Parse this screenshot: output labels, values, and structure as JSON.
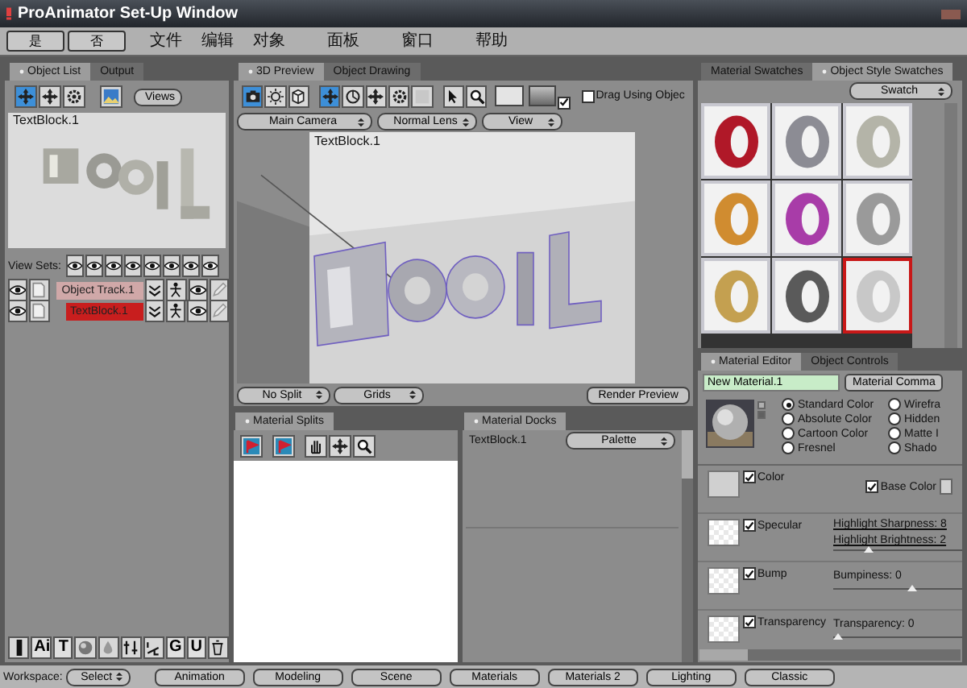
{
  "window": {
    "title": "ProAnimator Set-Up Window"
  },
  "dialog_buttons": [
    "是",
    "否"
  ],
  "menu": [
    "文件",
    "编辑",
    "对象",
    "面板",
    "窗口",
    "帮助"
  ],
  "object_list_panel": {
    "tabs": [
      {
        "label": "Object List",
        "selected": true
      },
      {
        "label": "Output",
        "selected": false
      }
    ],
    "toolbar": [
      {
        "selected": true
      },
      {
        "selected": false
      },
      {
        "selected": false
      },
      {
        "selected": false
      }
    ],
    "views_dropdown": "Views",
    "preview_label": "TextBlock.1",
    "view_sets_label": "View Sets:",
    "tracks": [
      {
        "name": "Object Track.1",
        "selected": false,
        "children": [
          {
            "name": "TextBlock.1",
            "selected": true
          }
        ]
      }
    ],
    "tools": [
      {
        "kind": "icon"
      },
      {
        "kind": "text",
        "label": "Ai"
      },
      {
        "kind": "text",
        "label": "T"
      },
      {
        "kind": "icon"
      },
      {
        "kind": "icon"
      },
      {
        "kind": "icon"
      },
      {
        "kind": "icon"
      },
      {
        "kind": "text",
        "label": "G"
      },
      {
        "kind": "text",
        "label": "U"
      },
      {
        "kind": "icon"
      }
    ]
  },
  "preview_panel": {
    "tabs": [
      {
        "label": "3D Preview",
        "selected": true
      },
      {
        "label": "Object Drawing",
        "selected": false
      }
    ],
    "toolbar": [
      {
        "selected": true
      },
      {
        "selected": false
      },
      {
        "selected": false
      },
      {
        "selected": true
      },
      {
        "selected": false
      },
      {
        "selected": false
      },
      {
        "selected": false
      },
      {
        "selected": false
      },
      {
        "selected": false
      },
      {
        "selected": false
      }
    ],
    "background_toggle": {
      "checked": true
    },
    "drag_using_objects": {
      "label": "Drag Using Objec",
      "checked": false
    },
    "camera": "Main Camera",
    "lens": "Normal Lens",
    "view": "View",
    "viewport_label": "TextBlock.1",
    "split": "No Split",
    "grids": "Grids",
    "render_button": "Render Preview"
  },
  "material_splits": {
    "tab": "Material Splits"
  },
  "material_docks": {
    "tab": "Material Docks",
    "object": "TextBlock.1",
    "palette": "Palette"
  },
  "swatch_panel": {
    "tabs": [
      {
        "label": "Material Swatches",
        "selected": false
      },
      {
        "label": "Object Style Swatches",
        "selected": true
      }
    ],
    "dropdown": "Swatch",
    "swatches": [
      {
        "color": "#b01828",
        "selected": false
      },
      {
        "color": "#8c8c94",
        "selected": false
      },
      {
        "color": "#b4b4a8",
        "selected": false
      },
      {
        "color": "#d08c30",
        "selected": false
      },
      {
        "color": "#a83ca8",
        "selected": false
      },
      {
        "color": "#9a9a9a",
        "selected": false
      },
      {
        "color": "#c4a050",
        "selected": false
      },
      {
        "color": "#5a5a5a",
        "selected": false
      },
      {
        "color": "#c8c8c8",
        "selected": true
      }
    ]
  },
  "material_editor": {
    "tabs": [
      {
        "label": "Material Editor",
        "selected": true
      },
      {
        "label": "Object Controls",
        "selected": false
      }
    ],
    "name": "New Material.1",
    "command_button": "Material Comma",
    "color_modes": [
      {
        "label": "Standard Color",
        "selected": true
      },
      {
        "label": "Absolute Color",
        "selected": false
      },
      {
        "label": "Cartoon Color",
        "selected": false
      },
      {
        "label": "Fresnel",
        "selected": false
      }
    ],
    "render_modes": [
      {
        "label": "Wirefra",
        "selected": false
      },
      {
        "label": "Hidden",
        "selected": false
      },
      {
        "label": "Matte I",
        "selected": false
      },
      {
        "label": "Shado",
        "selected": false
      }
    ],
    "channels": [
      {
        "kind": "color",
        "label": "Color",
        "checked": true,
        "base_color": {
          "label": "Base Color",
          "checked": true
        }
      },
      {
        "kind": "specular",
        "label": "Specular",
        "checked": true,
        "sliders": [
          {
            "reading": "Highlight Sharpness: 8"
          },
          {
            "reading": "Highlight Brightness: 2",
            "level": 0.25
          }
        ]
      },
      {
        "kind": "slider",
        "label": "Bump",
        "checked": true,
        "reading": "Bumpiness: 0",
        "level": 0.6
      },
      {
        "kind": "slider",
        "label": "Transparency",
        "checked": true,
        "reading": "Transparency: 0",
        "level": 0.0
      }
    ]
  },
  "workspace_bar": {
    "label": "Workspace:",
    "select": "Select",
    "buttons": [
      "Animation",
      "Modeling",
      "Scene",
      "Materials",
      "Materials 2",
      "Lighting",
      "Classic"
    ]
  }
}
